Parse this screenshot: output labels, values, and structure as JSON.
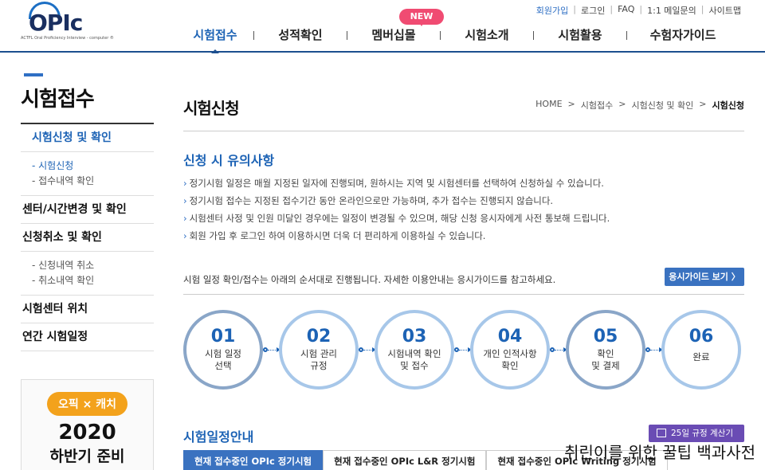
{
  "logo": {
    "text": "OPIc",
    "sub": "ACTFL Oral Proficiency Interview - computer ®"
  },
  "util_links": [
    "회원가입",
    "로그인",
    "FAQ",
    "1:1 메일문의",
    "사이트맵"
  ],
  "gnb": [
    "시험접수",
    "성적확인",
    "멤버십몰",
    "시험소개",
    "시험활용",
    "수험자가이드"
  ],
  "new_badge": "NEW",
  "sidebar": {
    "title": "시험접수",
    "sections": [
      {
        "label": "시험신청 및 확인",
        "subs": [
          "- 시험신청",
          "- 접수내역 확인"
        ]
      },
      {
        "label": "센터/시간변경 및 확인",
        "subs": []
      },
      {
        "label": "신청취소 및 확인",
        "subs": [
          "- 신청내역 취소",
          "- 취소내역 확인"
        ]
      },
      {
        "label": "시험센터 위치",
        "subs": []
      },
      {
        "label": "연간 시험일정",
        "subs": []
      }
    ]
  },
  "banner": {
    "pill": "오픽 × 캐치",
    "year": "2020",
    "sub": "하반기 준비"
  },
  "page": {
    "title": "시험신청",
    "breadcrumb": [
      "HOME",
      "시험접수",
      "시험신청 및 확인",
      "시험신청"
    ]
  },
  "notice": {
    "title": "신청 시 유의사항",
    "items": [
      "정기시험 일정은 매월 지정된 일자에 진행되며, 원하시는 지역 및 시험센터를 선택하여 신청하실 수 있습니다.",
      "정기시험 접수는 지정된 접수기간 동안 온라인으로만 가능하며, 추가 접수는 진행되지 않습니다.",
      "시험센터 사정 및 인원 미달인 경우에는 일정이 변경될 수 있으며, 해당 신청 응시자에게 사전 통보해 드립니다.",
      "회원 가입 후 로그인 하여 이용하시면 더욱 더 편리하게 이용하실 수 있습니다."
    ]
  },
  "guide": {
    "text": "시험 일정 확인/접수는 아래의 순서대로 진행됩니다. 자세한 이용안내는 응시가이드를 참고하세요.",
    "button": "응시가이드 보기 〉"
  },
  "steps": [
    {
      "num": "01",
      "label": [
        "시험 일정",
        "선택"
      ]
    },
    {
      "num": "02",
      "label": [
        "시험 관리",
        "규정"
      ]
    },
    {
      "num": "03",
      "label": [
        "시험내역 확인",
        "및 접수"
      ]
    },
    {
      "num": "04",
      "label": [
        "개인 인적사항",
        "확인"
      ]
    },
    {
      "num": "05",
      "label": [
        "확인",
        "및 결제"
      ]
    },
    {
      "num": "06",
      "label": [
        "완료"
      ]
    }
  ],
  "schedule": {
    "title": "시험일정안내",
    "calc_button": "25일 규정 계산기",
    "tabs": [
      "현재 접수중인 OPIc 정기시험",
      "현재 접수중인 OPIc L&R 정기시험",
      "현재 접수중인 OPIc Writing 정기시험"
    ]
  },
  "watermark": "취린이를 위한 꿀팁 백과사전",
  "colors": {
    "accent": "#1d63b5",
    "button": "#3a72c0",
    "badge": "#f04b72",
    "calc": "#6a4cb4"
  }
}
